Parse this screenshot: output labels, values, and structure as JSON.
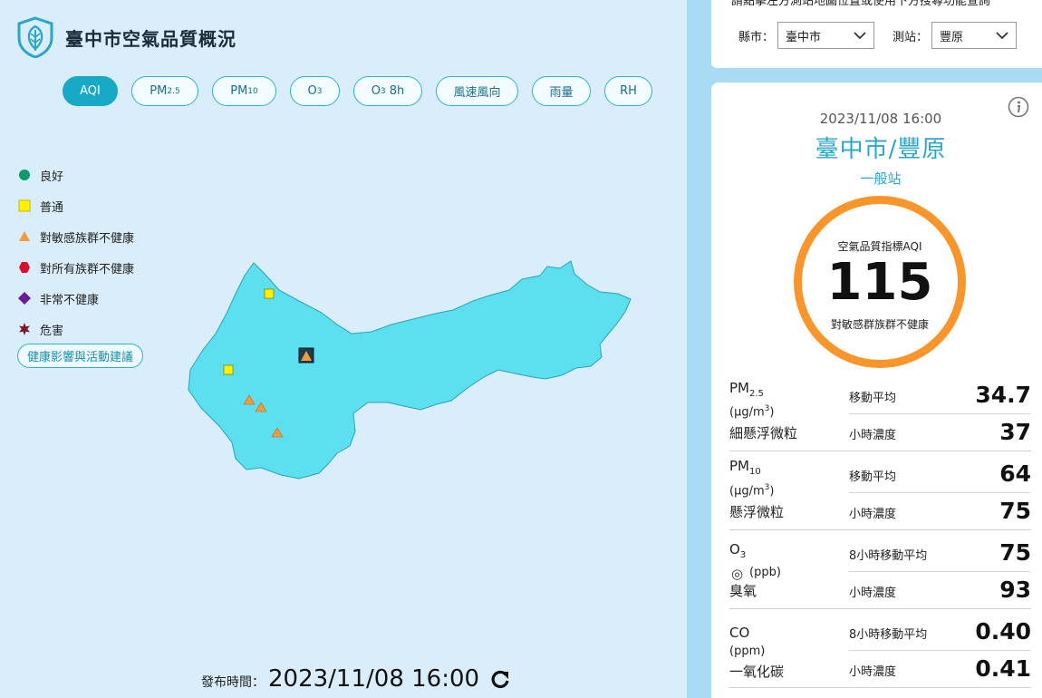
{
  "app": {
    "title": "臺中市空氣品質概況"
  },
  "tabs": [
    {
      "id": "aqi",
      "label": "AQI",
      "active": true
    },
    {
      "id": "pm25",
      "label": "PM",
      "sub": "2.5"
    },
    {
      "id": "pm10",
      "label": "PM",
      "sub": "10"
    },
    {
      "id": "o3",
      "label": "O",
      "sub": "3"
    },
    {
      "id": "o38h",
      "label": "O",
      "sub": "3",
      "suffix": " 8h"
    },
    {
      "id": "wind",
      "label": "風速風向"
    },
    {
      "id": "rain",
      "label": "雨量"
    },
    {
      "id": "rh",
      "label": "RH"
    }
  ],
  "legend": [
    {
      "label": "良好",
      "shape": "circle",
      "color": "#0f9a67"
    },
    {
      "label": "普通",
      "shape": "square",
      "color": "#fff200"
    },
    {
      "label": "對敏感族群不健康",
      "shape": "triangle",
      "color": "#f49a3c"
    },
    {
      "label": "對所有族群不健康",
      "shape": "hexagon",
      "color": "#d8102c"
    },
    {
      "label": "非常不健康",
      "shape": "diamond",
      "color": "#6a1b9a"
    },
    {
      "label": "危害",
      "shape": "star",
      "color": "#7b1530"
    }
  ],
  "health_button": "健康影響與活動建議",
  "release": {
    "label": "發布時間：",
    "time": "2023/11/08 16:00"
  },
  "search": {
    "hint": "請點擊左方測站地圖位置或使用下方搜尋功能查詢",
    "county_label": "縣市：",
    "county_value": "臺中市",
    "station_label": "測站：",
    "station_value": "豐原"
  },
  "detail": {
    "date": "2023/11/08 16:00",
    "station": "臺中市/豐原",
    "station_type": "一般站",
    "aqi_label": "空氣品質指標AQI",
    "aqi_value": "115",
    "aqi_status": "對敏感群族群不健康",
    "aqi_color": "#f8952b"
  },
  "pollutants": [
    {
      "name": "PM",
      "sub": "2.5",
      "unit": "(μg/m",
      "unit_sup": "3",
      "unit_end": ")",
      "cn": "細懸浮微粒",
      "rows": [
        {
          "label": "移動平均",
          "value": "34.7"
        },
        {
          "label": "小時濃度",
          "value": "37"
        }
      ]
    },
    {
      "name": "PM",
      "sub": "10",
      "unit": "(μg/m",
      "unit_sup": "3",
      "unit_end": ")",
      "cn": "懸浮微粒",
      "rows": [
        {
          "label": "移動平均",
          "value": "64"
        },
        {
          "label": "小時濃度",
          "value": "75"
        }
      ]
    },
    {
      "name": "O",
      "sub": "3",
      "unit": "(ppb)",
      "unit_sup": "",
      "unit_end": "",
      "cn": "臭氧",
      "icon": "◎",
      "rows": [
        {
          "label": "8小時移動平均",
          "value": "75"
        },
        {
          "label": "小時濃度",
          "value": "93"
        }
      ]
    },
    {
      "name": "CO",
      "sub": "",
      "unit": "(ppm)",
      "unit_sup": "",
      "unit_end": "",
      "cn": "一氧化碳",
      "rows": [
        {
          "label": "8小時移動平均",
          "value": "0.40"
        },
        {
          "label": "小時濃度",
          "value": "0.41"
        }
      ]
    }
  ],
  "map": {
    "fill": "#5ce0ef",
    "stations": [
      {
        "shape": "square",
        "color": "#fff200"
      },
      {
        "shape": "square",
        "color": "#fff200"
      },
      {
        "shape": "triangle",
        "color": "#f49a3c"
      },
      {
        "shape": "triangle",
        "color": "#f49a3c"
      },
      {
        "shape": "triangle",
        "color": "#f49a3c"
      },
      {
        "shape": "selected-triangle",
        "color": "#f49a3c"
      }
    ]
  }
}
